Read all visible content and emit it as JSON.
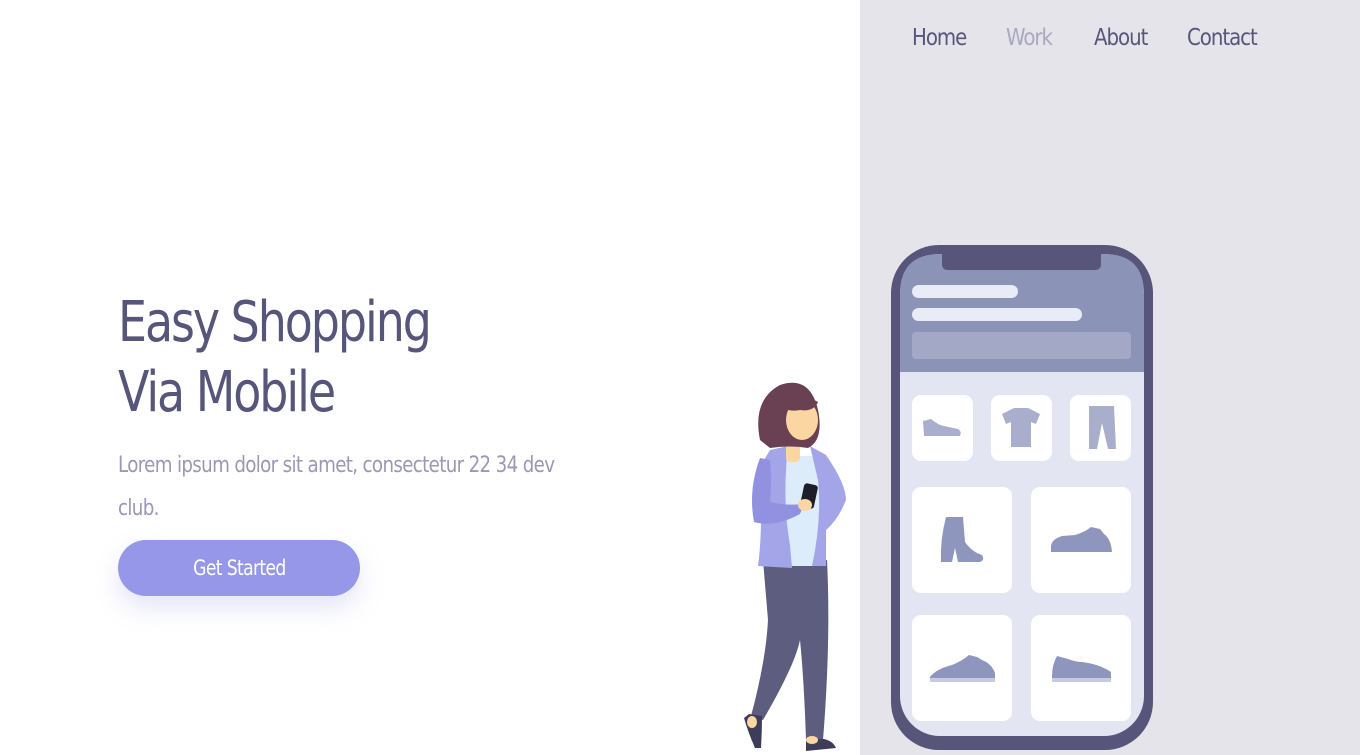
{
  "nav": {
    "items": [
      {
        "label": "Home",
        "active": false
      },
      {
        "label": "Work",
        "active": true
      },
      {
        "label": "About",
        "active": false
      },
      {
        "label": "Contact",
        "active": false
      }
    ]
  },
  "hero": {
    "title_line1": "Easy Shopping",
    "title_line2": "Via Mobile",
    "subtitle": "Lorem ipsum dolor sit amet, consectetur 22 34 dev club.",
    "cta_label": "Get Started"
  },
  "colors": {
    "accent": "#9697e8",
    "heading": "#56557a",
    "muted": "#9a99b3",
    "panel_bg": "#e5e4eb",
    "phone_frame": "#57567a"
  },
  "illustration": {
    "icons": [
      "shoe-icon",
      "tshirt-icon",
      "pants-icon",
      "boot-icon",
      "sneaker-icon",
      "sneaker-icon",
      "sneaker-icon"
    ]
  }
}
